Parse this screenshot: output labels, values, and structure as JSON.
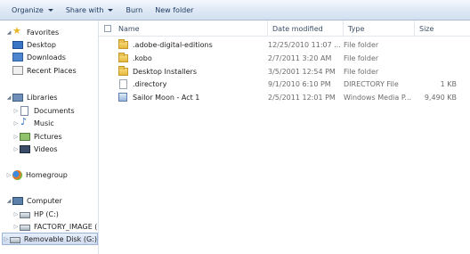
{
  "toolbar": {
    "organize": "Organize",
    "share_with": "Share with",
    "burn": "Burn",
    "new_folder": "New folder"
  },
  "nav": {
    "favorites": "Favorites",
    "desktop": "Desktop",
    "downloads": "Downloads",
    "recent_places": "Recent Places",
    "libraries": "Libraries",
    "documents": "Documents",
    "music": "Music",
    "pictures": "Pictures",
    "videos": "Videos",
    "homegroup": "Homegroup",
    "computer": "Computer",
    "hp_c": "HP (C:)",
    "factory_image": "FACTORY_IMAGE (D",
    "removable_disk": "Removable Disk (G:)"
  },
  "columns": {
    "name": "Name",
    "date_modified": "Date modified",
    "type": "Type",
    "size": "Size"
  },
  "files": [
    {
      "name": ".adobe-digital-editions",
      "date": "12/25/2010 11:07 ...",
      "type": "File folder",
      "size": "",
      "icon": "folder-icon"
    },
    {
      "name": ".kobo",
      "date": "2/7/2011 3:20 AM",
      "type": "File folder",
      "size": "",
      "icon": "folder-icon"
    },
    {
      "name": "Desktop Installers",
      "date": "3/5/2001 12:54 PM",
      "type": "File folder",
      "size": "",
      "icon": "folder-icon"
    },
    {
      "name": ".directory",
      "date": "9/1/2010 6:10 PM",
      "type": "DIRECTORY File",
      "size": "1 KB",
      "icon": "file-icon"
    },
    {
      "name": "Sailor Moon - Act 1",
      "date": "2/5/2011 12:01 PM",
      "type": "Windows Media P...",
      "size": "9,490 KB",
      "icon": "media-file-icon"
    }
  ]
}
